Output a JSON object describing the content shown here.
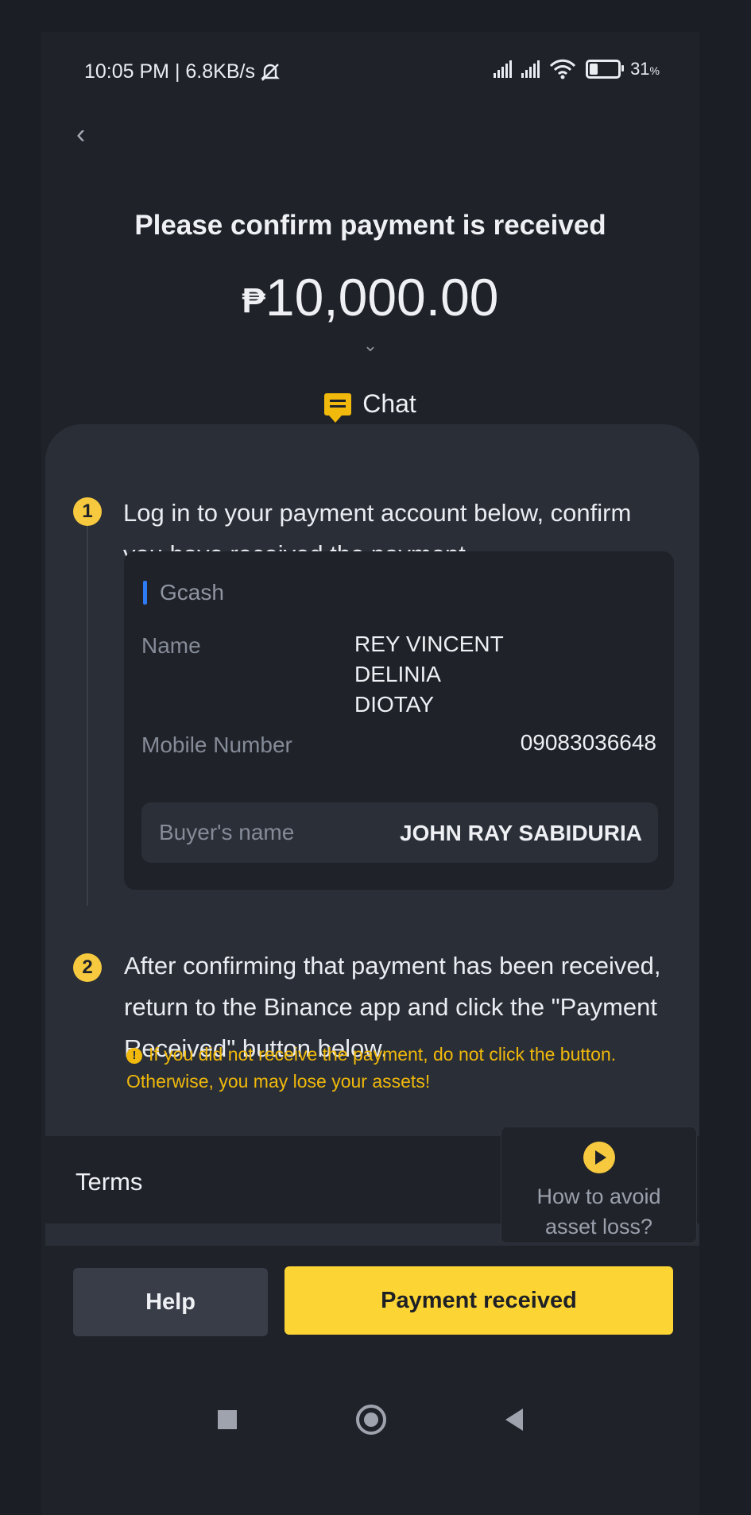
{
  "status_bar": {
    "time_speed": "10:05 PM | 6.8KB/s",
    "battery": "31",
    "battery_unit": "%"
  },
  "header": {
    "title": "Please confirm payment is received",
    "currency_symbol": "₱",
    "amount": "10,000.00",
    "chat_label": "Chat"
  },
  "steps": [
    {
      "number": "1",
      "text": "Log in to your payment account below, confirm you have received the payment."
    },
    {
      "number": "2",
      "text": "After confirming that payment has been received, return to the Binance app and click the \"Payment Received\" button below."
    }
  ],
  "payment_card": {
    "method": "Gcash",
    "name_label": "Name",
    "name_value_line1": "REY VINCENT DELINIA",
    "name_value_line2": "DIOTAY",
    "mobile_label": "Mobile Number",
    "mobile_value": "09083036648",
    "buyer_label": "Buyer's name",
    "buyer_value": "JOHN RAY SABIDURIA"
  },
  "warning": {
    "line1": "If you did not receive the payment, do not click the button.",
    "line2": "Otherwise, you may lose your assets!"
  },
  "terms_label": "Terms",
  "avoid_loss": {
    "line1": "How to avoid",
    "line2": "asset loss?"
  },
  "buttons": {
    "help": "Help",
    "payment_received": "Payment received"
  },
  "colors": {
    "accent": "#fcd535",
    "background": "#1f2229",
    "panel": "#2a2e37",
    "method_bar": "#2f7bf5"
  }
}
